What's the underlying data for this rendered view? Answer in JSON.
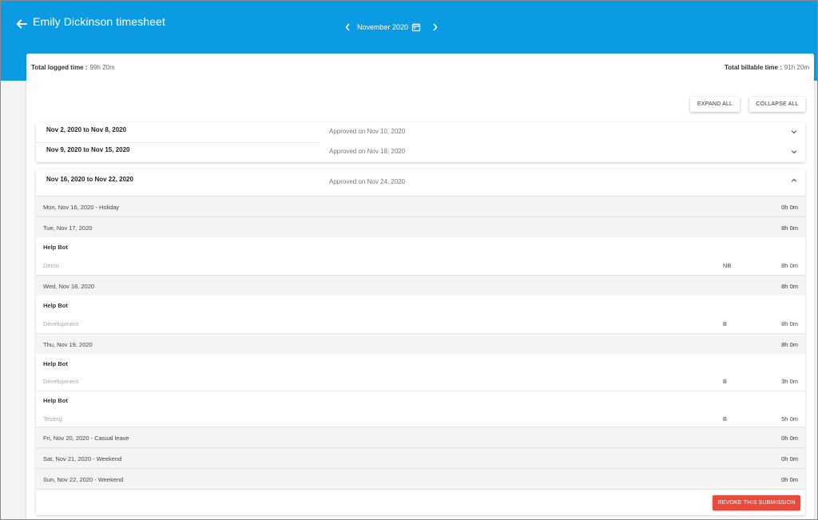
{
  "header": {
    "title": "Emily Dickinson timesheet",
    "month": "November 2020",
    "accent_color": "#0a9be3",
    "back_icon": "arrow-left-icon",
    "calendar_icon": "calendar-icon"
  },
  "totals": {
    "logged_label": "Total logged time :",
    "logged_value": "99h 20m",
    "billable_label": "Total billable time :",
    "billable_value": "91h 20m"
  },
  "actions": {
    "expand_all": "EXPAND ALL",
    "collapse_all": "COLLAPSE ALL"
  },
  "weeks": [
    {
      "range": "Nov 2, 2020 to Nov 8, 2020",
      "approved": "Approved on Nov 10, 2020",
      "expanded": false
    },
    {
      "range": "Nov 9, 2020 to Nov 15, 2020",
      "approved": "Approved on Nov 18, 2020",
      "expanded": false
    },
    {
      "range": "Nov 16, 2020 to Nov 22, 2020",
      "approved": "Approved on Nov 24, 2020",
      "expanded": true
    }
  ],
  "days": [
    {
      "label": "Mon, Nov 16, 2020 - Holiday",
      "hours": "0h 0m",
      "entries": []
    },
    {
      "label": "Tue, Nov 17, 2020",
      "hours": "8h 0m",
      "entries": [
        {
          "project": "Help Bot",
          "task": "Demo",
          "billable": "NB",
          "hours": "8h 0m"
        }
      ]
    },
    {
      "label": "Wed, Nov 18, 2020",
      "hours": "8h 0m",
      "entries": [
        {
          "project": "Help Bot",
          "task": "Development",
          "billable": "B",
          "hours": "8h 0m"
        }
      ]
    },
    {
      "label": "Thu, Nov 19, 2020",
      "hours": "8h 0m",
      "entries": [
        {
          "project": "Help Bot",
          "task": "Development",
          "billable": "B",
          "hours": "3h 0m"
        },
        {
          "project": "Help Bot",
          "task": "Testing",
          "billable": "B",
          "hours": "5h 0m"
        }
      ]
    },
    {
      "label": "Fri, Nov 20, 2020 - Casual leave",
      "hours": "0h 0m",
      "entries": []
    },
    {
      "label": "Sat, Nov 21, 2020 - Weekend",
      "hours": "0h 0m",
      "entries": []
    },
    {
      "label": "Sun, Nov 22, 2020 - Weekend",
      "hours": "0h 0m",
      "entries": []
    }
  ],
  "revoke_label": "REVOKE THIS SUBMISSION",
  "revoke_color": "#e84a3c"
}
